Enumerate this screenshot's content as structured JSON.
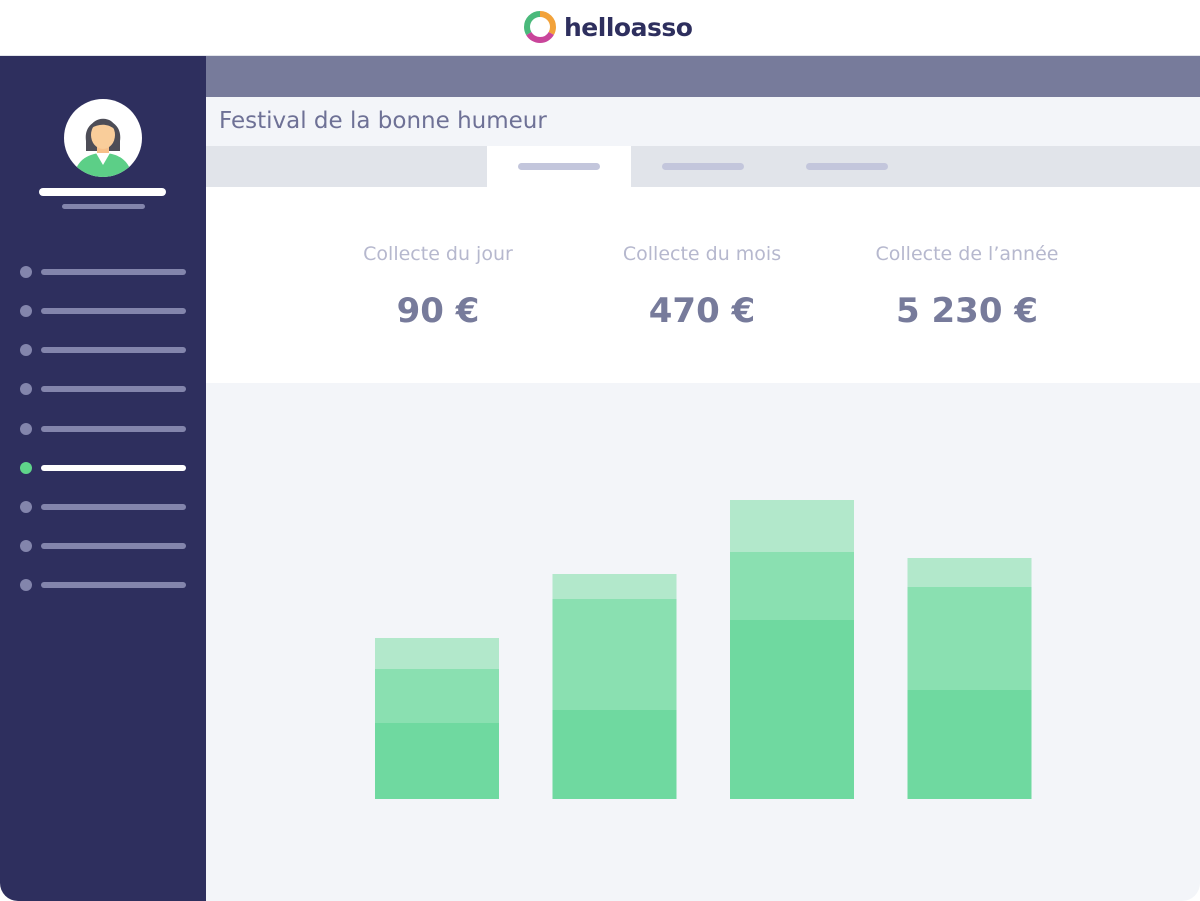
{
  "brand": {
    "name": "helloasso"
  },
  "page": {
    "title": "Festival de la bonne humeur"
  },
  "stats": [
    {
      "label": "Collecte du jour",
      "value": "90 €"
    },
    {
      "label": "Collecte du mois",
      "value": "470 €"
    },
    {
      "label": "Collecte de l’année",
      "value": "5 230 €"
    }
  ],
  "sidebar": {
    "active_index": 5,
    "item_count": 9
  },
  "tabs": {
    "count": 3,
    "active_index": 0
  },
  "colors": {
    "sidebar_bg": "#2e2f5e",
    "accent_green": "#5fd48a",
    "bar_light": "#b2e8cb",
    "bar_mid": "#8ae0b1",
    "bar_dark": "#6fd9a0"
  },
  "chart_data": {
    "type": "bar",
    "stacked": true,
    "categories": [
      "",
      "",
      "",
      ""
    ],
    "series": [
      {
        "values": [
          76,
          89,
          179,
          109
        ]
      },
      {
        "values": [
          54,
          111,
          68,
          103
        ]
      },
      {
        "values": [
          31,
          25,
          52,
          29
        ]
      }
    ],
    "ylim": [
      0,
      300
    ],
    "grid": false
  }
}
